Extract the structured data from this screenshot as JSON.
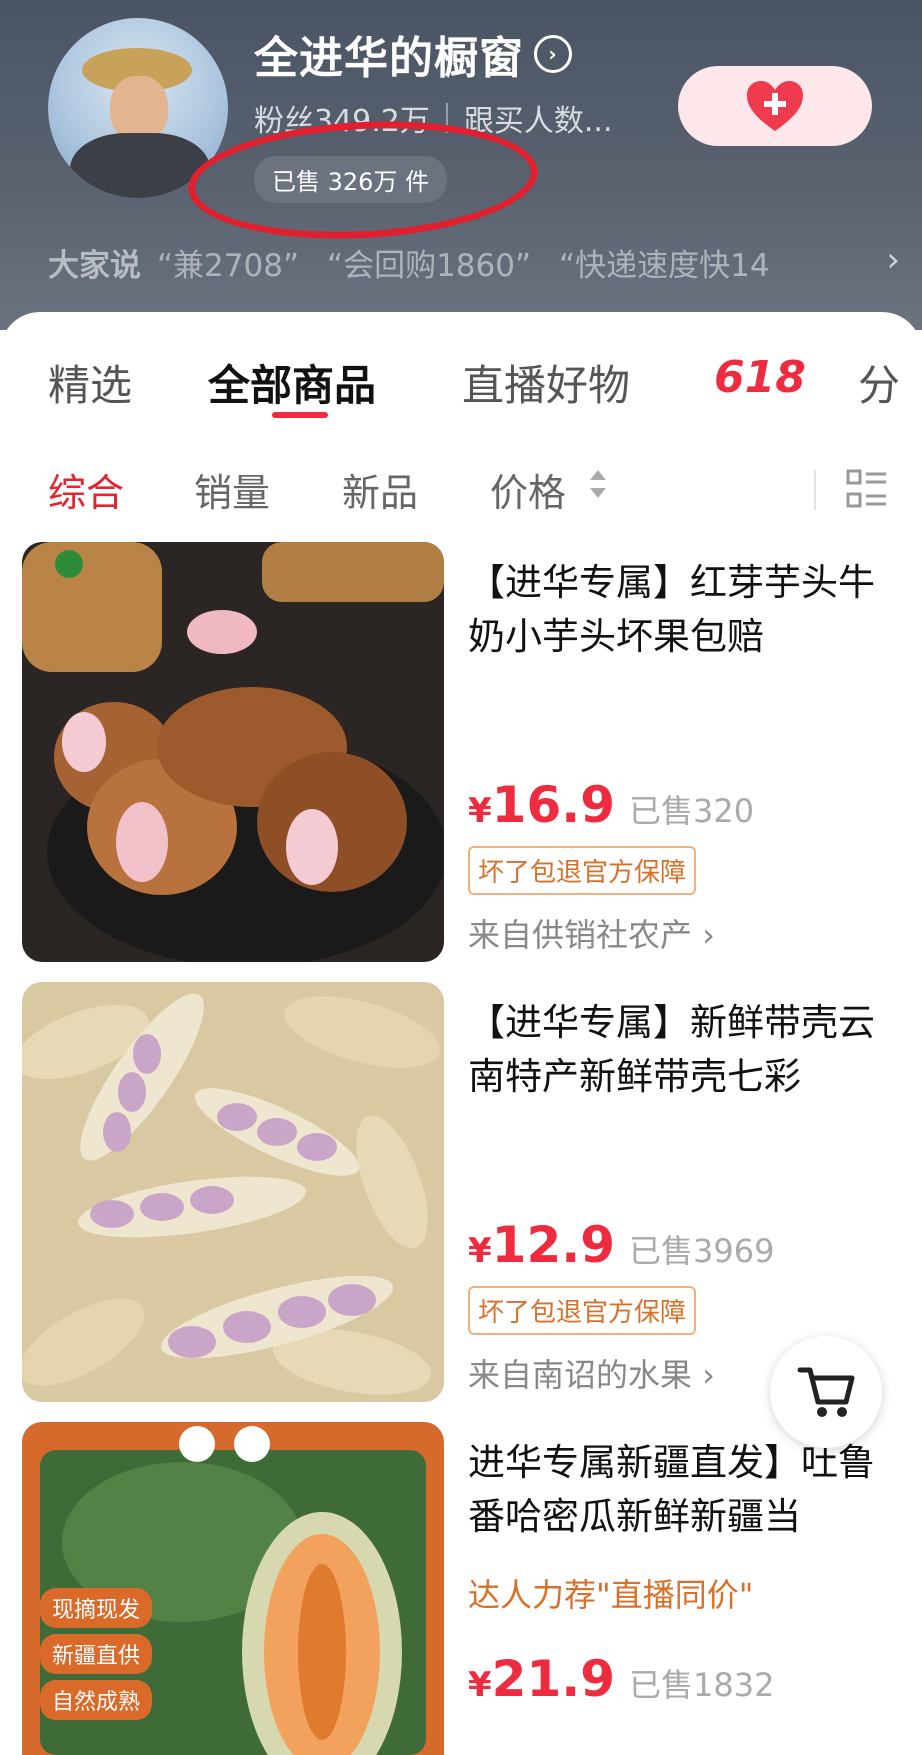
{
  "shop": {
    "name": "全进华的橱窗",
    "name_arrow": "›",
    "fans": "粉丝349.2万",
    "followers": "跟买人数...",
    "sold": "已售 326万 件",
    "follow_icon": "heart-plus-icon"
  },
  "reviews": {
    "label": "大家说",
    "items": [
      "“兼2708”",
      "“会回购1860”",
      "“快递速度快14"
    ],
    "chevron": "›"
  },
  "tabs": [
    "精选",
    "全部商品",
    "直播好物",
    "618",
    "分"
  ],
  "filters": {
    "items": [
      "综合",
      "销量",
      "新品",
      "价格"
    ]
  },
  "products": [
    {
      "title": "【进华专属】红芽芋头牛奶小芋头坏果包赔",
      "yen": "¥",
      "price": "16.9",
      "sold": "已售320",
      "tag": "坏了包退官方保障",
      "source": "来自供销社农产 ›"
    },
    {
      "title": "【进华专属】新鲜带壳云南特产新鲜带壳七彩",
      "yen": "¥",
      "price": "12.9",
      "sold": "已售3969",
      "tag": "坏了包退官方保障",
      "source": "来自南诏的水果 ›"
    },
    {
      "title": "进华专属新疆直发】吐鲁番哈密瓜新鲜新疆当",
      "subtitle": "达人力荐\"直播同价\"",
      "yen": "¥",
      "price": "21.9",
      "sold": "已售1832",
      "badges": [
        "现摘现发",
        "新疆直供",
        "自然成熟"
      ]
    }
  ],
  "colors": {
    "accent": "#ef2b3f",
    "header_bg": "#4a5463",
    "tag_orange": "#d9702a"
  }
}
